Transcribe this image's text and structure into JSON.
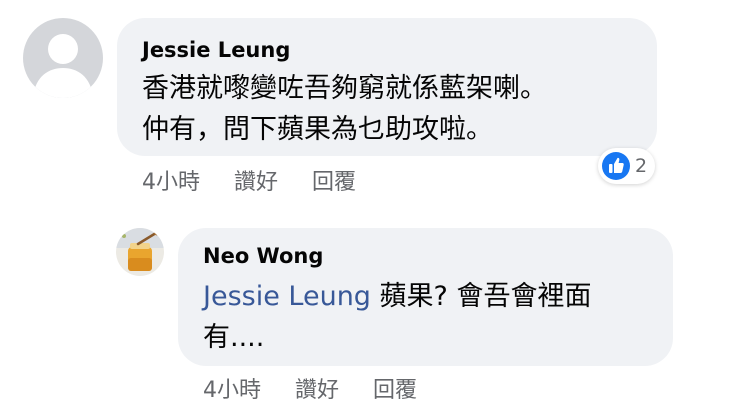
{
  "comments": [
    {
      "author": "Jessie Leung",
      "lines": [
        "香港就嚟變咗吾夠窮就係藍架喇。",
        "仲有，問下蘋果為乜助攻啦。"
      ],
      "time": "4小時",
      "like_label": "讚好",
      "reply_label": "回覆",
      "reaction_count": "2",
      "reaction_icon": "like-icon",
      "avatar_icon": "default-person-icon"
    },
    {
      "author": "Neo Wong",
      "mention": "Jessie Leung",
      "line1_rest": " 蘋果? 會吾會裡面",
      "line2": "有....",
      "time": "4小時",
      "like_label": "讚好",
      "reply_label": "回覆",
      "avatar_icon": "honey-jar-icon"
    }
  ],
  "colors": {
    "bubble": "#f0f2f5",
    "mention": "#385898",
    "meta": "#65676b",
    "like_blue": "#1877f2"
  }
}
